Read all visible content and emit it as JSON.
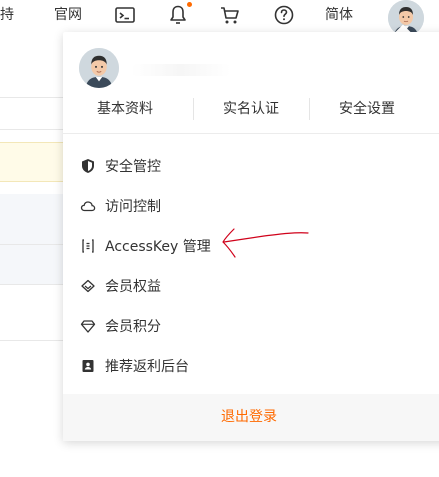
{
  "topbar": {
    "support_text": "支持",
    "official_text": "官网",
    "lang_text": "简体",
    "icons": [
      "terminal-icon",
      "bell-icon",
      "cart-icon",
      "help-icon"
    ],
    "notification_color": "#ff6a00"
  },
  "profile_tabs": [
    {
      "label": "基本资料"
    },
    {
      "label": "实名认证"
    },
    {
      "label": "安全设置"
    }
  ],
  "menu": [
    {
      "label": "安全管控",
      "icon": "shield-icon"
    },
    {
      "label": "访问控制",
      "icon": "cloud-icon"
    },
    {
      "label": "AccessKey 管理",
      "icon": "key-icon"
    },
    {
      "label": "会员权益",
      "icon": "diamond-icon"
    },
    {
      "label": "会员积分",
      "icon": "gem-icon"
    },
    {
      "label": "推荐返利后台",
      "icon": "rebate-icon"
    }
  ],
  "logout_label": "退出登录",
  "colors": {
    "accent": "#ff6a00",
    "annotation": "#d0021b",
    "highlight_row": "#fffbe8",
    "alt_row": "#f5f7fa"
  }
}
